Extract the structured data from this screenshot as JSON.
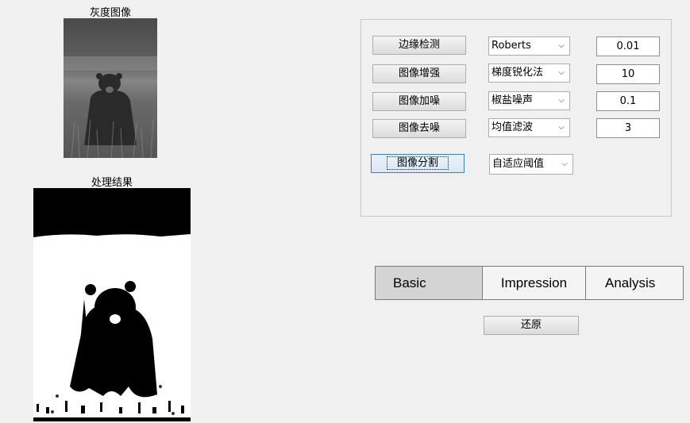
{
  "labels": {
    "gray_image": "灰度图像",
    "result": "处理结果"
  },
  "rows": [
    {
      "button": "边缘检测",
      "select": "Roberts",
      "value": "0.01"
    },
    {
      "button": "图像增强",
      "select": "梯度锐化法",
      "value": "10"
    },
    {
      "button": "图像加噪",
      "select": "椒盐噪声",
      "value": "0.1"
    },
    {
      "button": "图像去噪",
      "select": "均值滤波",
      "value": "3"
    }
  ],
  "segment": {
    "button": "图像分割",
    "select": "自适应阈值"
  },
  "tabs": [
    "Basic",
    "Impression",
    "Analysis"
  ],
  "reset_label": "还原"
}
